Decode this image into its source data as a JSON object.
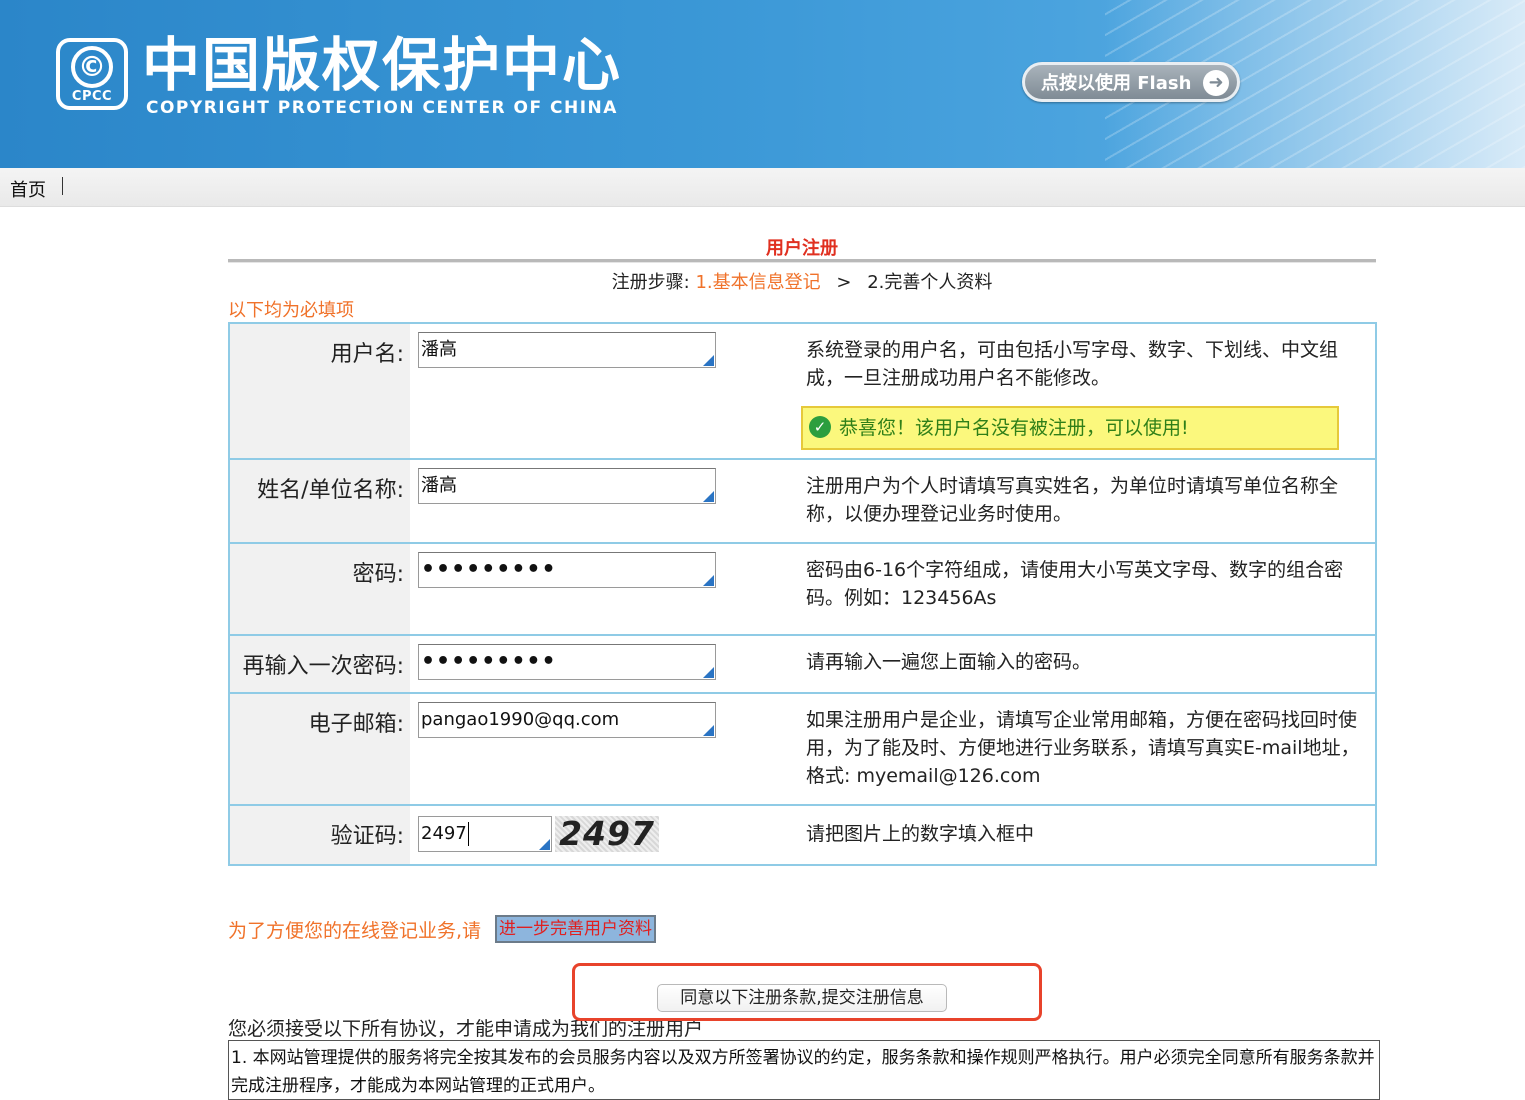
{
  "header": {
    "logo_abbr": "CPCC",
    "logo_symbol": "©",
    "title": "中国版权保护中心",
    "subtitle": "COPYRIGHT PROTECTION CENTER OF CHINA",
    "flash_button": "点按以使用 Flash",
    "flash_icon": "arrow-right-circle-icon"
  },
  "nav": {
    "home": "首页"
  },
  "form": {
    "title": "用户注册",
    "steps_prefix": "注册步骤:",
    "step1": "1.基本信息登记",
    "step_separator": ">",
    "step2": "2.完善个人资料",
    "required_note": "以下均为必填项",
    "rows": [
      {
        "label": "用户名:",
        "value": "潘高",
        "desc": "系统登录的用户名，可由包括小写字母、数字、下划线、中文组成，一旦注册成功用户名不能修改。",
        "status_message": "恭喜您！该用户名没有被注册，可以使用!"
      },
      {
        "label": "姓名/单位名称:",
        "value": "潘高",
        "desc": "注册用户为个人时请填写真实姓名，为单位时请填写单位名称全称，以便办理登记业务时使用。"
      },
      {
        "label": "密码:",
        "value": "•••••••••",
        "desc": "密码由6-16个字符组成，请使用大小写英文字母、数字的组合密码。例如：123456As"
      },
      {
        "label": "再输入一次密码:",
        "value": "•••••••••",
        "desc": "请再输入一遍您上面输入的密码。"
      },
      {
        "label": "电子邮箱:",
        "value": "pangao1990@qq.com",
        "desc": "如果注册用户是企业，请填写企业常用邮箱，方便在密码找回时使用，为了能及时、方便地进行业务联系，请填写真实E-mail地址，格式: myemail@126.com"
      },
      {
        "label": "验证码:",
        "value": "2497",
        "captcha_text": "2497",
        "desc": "请把图片上的数字填入框中"
      }
    ]
  },
  "bottom": {
    "note": "为了方便您的在线登记业务,请",
    "complete_button": "进一步完善用户资料",
    "submit_button": "同意以下注册条款,提交注册信息",
    "agree_note": "您必须接受以下所有协议，才能申请成为我们的注册用户",
    "terms_text": "1.  本网站管理提供的服务将完全按其发布的会员服务内容以及双方所签署协议的约定，服务条款和操作规则严格执行。用户必须完全同意所有服务条款并完成注册程序，才能成为本网站管理的正式用户。"
  },
  "colors": {
    "banner_blue": "#3a97d6",
    "accent_orange": "#f0722a",
    "title_red": "#e03020",
    "table_border": "#8fcbe6",
    "success_green": "#2f7f18",
    "success_bg": "#fbf87d",
    "highlight_frame": "#e8432b"
  }
}
